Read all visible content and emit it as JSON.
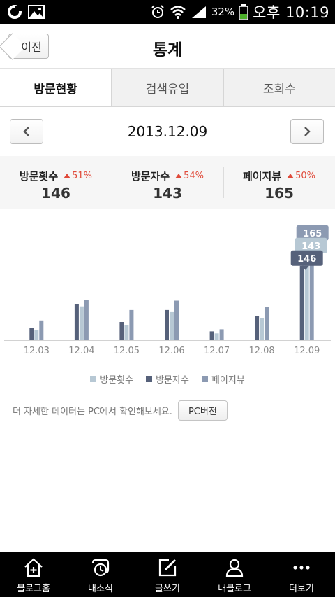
{
  "status_bar": {
    "battery_pct": "32%",
    "time": "오후 10:19"
  },
  "header": {
    "back_label": "이전",
    "title": "통계"
  },
  "tabs": [
    {
      "label": "방문현황",
      "active": true
    },
    {
      "label": "검색유입",
      "active": false
    },
    {
      "label": "조회수",
      "active": false
    }
  ],
  "date_nav": {
    "date": "2013.12.09"
  },
  "stats": [
    {
      "label": "방문횟수",
      "change": "51%",
      "value": "146"
    },
    {
      "label": "방문자수",
      "change": "54%",
      "value": "143"
    },
    {
      "label": "페이지뷰",
      "change": "50%",
      "value": "165"
    }
  ],
  "colors": {
    "visits": "#b7c8d4",
    "visitors": "#56617a",
    "pageviews": "#8c9ab2",
    "up_arrow": "#e04a3a"
  },
  "chart_data": {
    "type": "bar",
    "categories": [
      "12.03",
      "12.04",
      "12.05",
      "12.06",
      "12.07",
      "12.08",
      "12.09"
    ],
    "series": [
      {
        "name": "방문횟수",
        "values": [
          20,
          65,
          29,
          54,
          13,
          42,
          146
        ]
      },
      {
        "name": "방문자수",
        "values": [
          23,
          70,
          35,
          58,
          17,
          47,
          143
        ]
      },
      {
        "name": "페이지뷰",
        "values": [
          38,
          78,
          58,
          76,
          21,
          64,
          165
        ]
      }
    ],
    "highlighted_category": "12.09",
    "highlight_labels": [
      "165",
      "143",
      "146"
    ],
    "ylim": [
      0,
      175
    ],
    "grid": false
  },
  "legend": [
    {
      "label": "방문횟수"
    },
    {
      "label": "방문자수"
    },
    {
      "label": "페이지뷰"
    }
  ],
  "pc_note": {
    "text": "더 자세한 데이터는 PC에서 확인해보세요.",
    "button_label": "PC버전"
  },
  "bottom_nav": [
    {
      "label": "블로그홈",
      "icon": "home-plus-icon"
    },
    {
      "label": "내소식",
      "icon": "clock-icon"
    },
    {
      "label": "글쓰기",
      "icon": "edit-icon"
    },
    {
      "label": "내블로그",
      "icon": "person-icon"
    },
    {
      "label": "더보기",
      "icon": "more-icon"
    }
  ]
}
